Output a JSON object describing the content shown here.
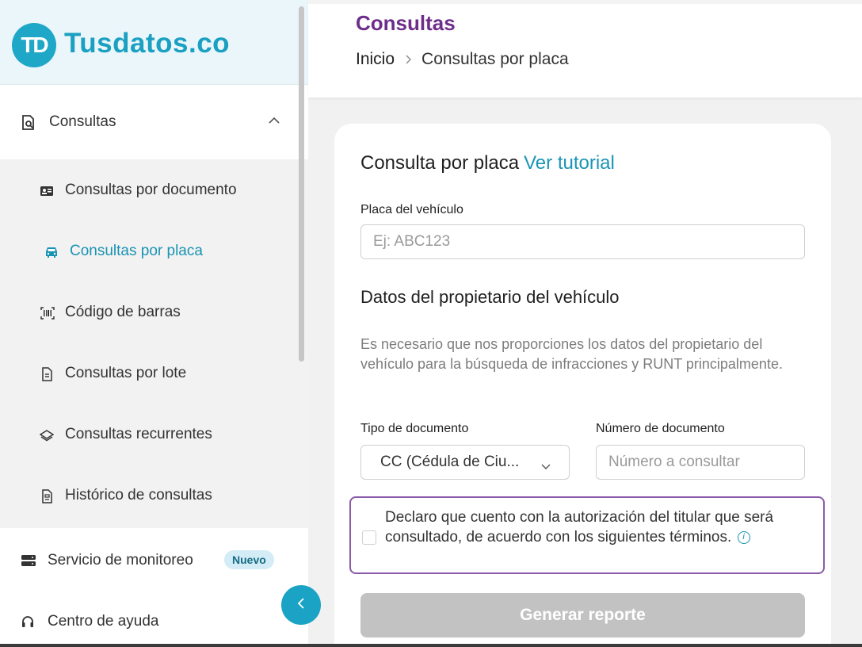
{
  "brand": {
    "logo_letters": "TD",
    "name": "Tusdatos.co"
  },
  "sidebar": {
    "group": {
      "label": "Consultas"
    },
    "items": [
      {
        "label": "Consultas por documento",
        "icon": "id-card-icon"
      },
      {
        "label": "Consultas por placa",
        "icon": "car-icon",
        "active": true
      },
      {
        "label": "Código de barras",
        "icon": "barcode-icon"
      },
      {
        "label": "Consultas por lote",
        "icon": "document-icon"
      },
      {
        "label": "Consultas recurrentes",
        "icon": "layers-icon"
      },
      {
        "label": "Histórico de consultas",
        "icon": "history-document-icon"
      }
    ],
    "monitoring": {
      "label": "Servicio de monitoreo",
      "badge": "Nuevo",
      "icon": "server-icon"
    },
    "help": {
      "label": "Centro de ayuda",
      "icon": "headset-icon"
    }
  },
  "header": {
    "title": "Consultas",
    "breadcrumb": {
      "home": "Inicio",
      "current": "Consultas por placa"
    }
  },
  "form": {
    "title": "Consulta por placa",
    "tutorial_link": "Ver tutorial",
    "plate_label": "Placa del vehículo",
    "plate_placeholder": "Ej: ABC123",
    "owner_section_title": "Datos del propietario del vehículo",
    "owner_description": "Es necesario que nos proporciones los datos del propietario del vehículo para la búsqueda de infracciones y RUNT principalmente.",
    "doc_type_label": "Tipo de documento",
    "doc_type_value": "CC (Cédula de Ciu...",
    "doc_number_label": "Número de documento",
    "doc_number_placeholder": "Número a consultar",
    "consent_text": "Declaro que cuento con la autorización del titular que será consultado, de acuerdo con los siguientes términos.",
    "consent_checked": false,
    "submit_label": "Generar reporte"
  },
  "colors": {
    "brand": "#1aa0c0",
    "title_purple": "#6e2d8a",
    "active_link": "#1a93b3",
    "consent_border": "#8b5aa8",
    "submit_disabled": "#c2c2c2"
  }
}
